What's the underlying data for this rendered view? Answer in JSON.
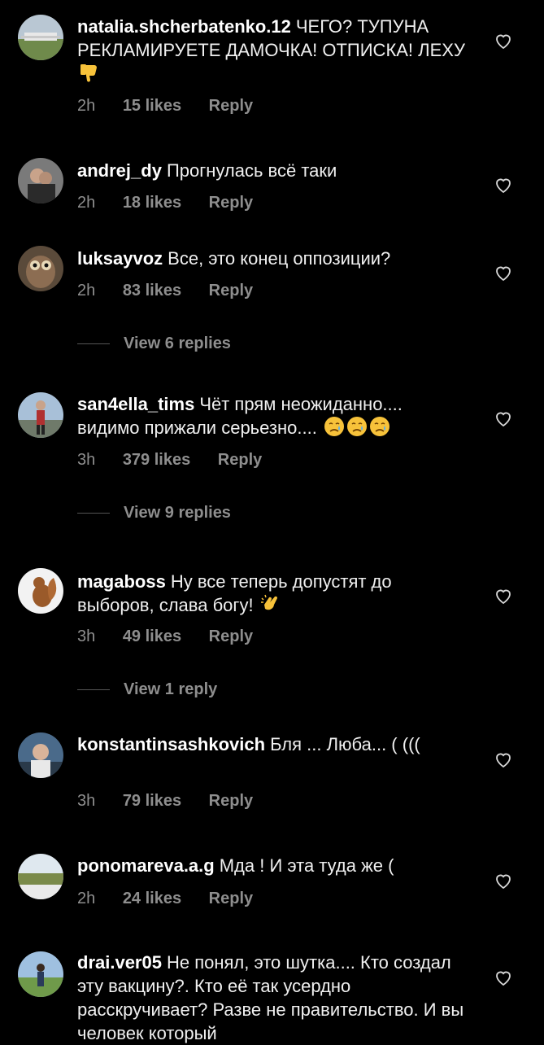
{
  "comments": [
    {
      "username": "natalia.shcherbatenko.12",
      "text": "ЧЕГО? ТУПУНА РЕКЛАМИРУЕТЕ ДАМОЧКА! ОТПИСКА! ЛЕХУ",
      "emoji": "thumbs-down",
      "time": "2h",
      "likes": "15 likes",
      "reply": "Reply"
    },
    {
      "username": "andrej_dy",
      "text": "Прогнулась всё таки",
      "time": "2h",
      "likes": "18 likes",
      "reply": "Reply"
    },
    {
      "username": "luksayvoz",
      "text": "Все, это конец оппозиции?",
      "time": "2h",
      "likes": "83 likes",
      "reply": "Reply",
      "view_replies": "View 6 replies"
    },
    {
      "username": "san4ella_tims",
      "text": "Чёт прям неожиданно.... видимо прижали серьезно....",
      "emoji": "crying-face x3",
      "time": "3h",
      "likes": "379 likes",
      "reply": "Reply",
      "view_replies": "View 9 replies"
    },
    {
      "username": "magaboss",
      "text": "Ну все теперь допустят до выборов, слава богу!",
      "emoji": "clapping-hands",
      "time": "3h",
      "likes": "49 likes",
      "reply": "Reply",
      "view_replies": "View 1 reply"
    },
    {
      "username": "konstantinsashkovich",
      "text": "Бля ... Люба... ( (((",
      "time": "3h",
      "likes": "79 likes",
      "reply": "Reply"
    },
    {
      "username": "ponomareva.a.g",
      "text": "Мда ! И эта туда же (",
      "time": "2h",
      "likes": "24 likes",
      "reply": "Reply"
    },
    {
      "username": "drai.ver05",
      "text": "Не понял, это шутка.... Кто создал эту вакцину?. Кто её так усердно расскручивает? Разве не правительство. И вы человек который"
    }
  ],
  "colors": {
    "background": "#000000",
    "primary_text": "#f5f5f5",
    "secondary_text": "#8e8e8e",
    "emoji_yellow": "#f7c23a"
  },
  "icons": {
    "like": "heart-outline-icon"
  }
}
